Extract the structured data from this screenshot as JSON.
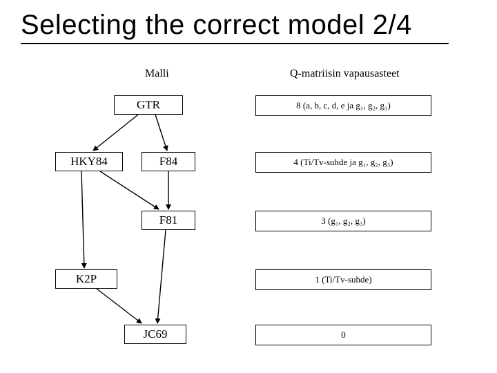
{
  "title": "Selecting the correct model 2/4",
  "columns": {
    "left_header": "Malli",
    "right_header": "Q-matriisin vapausasteet"
  },
  "nodes": {
    "gtr": "GTR",
    "hky84": "HKY84",
    "f84": "F84",
    "f81": "F81",
    "k2p": "K2P",
    "jc69": "JC69"
  },
  "dof": {
    "gtr": "8 (a, b, c, d, e ja g₁, g₂, g₃)",
    "hky": "4 (Ti/Tv-suhde ja g₁, g₂, g₃)",
    "f81": "3 (g₁, g₂, g₃)",
    "k2p": "1 (Ti/Tv-suhde)",
    "jc69": "0"
  },
  "edges": [
    {
      "from": "gtr",
      "to": "hky84"
    },
    {
      "from": "gtr",
      "to": "f84"
    },
    {
      "from": "hky84",
      "to": "f81"
    },
    {
      "from": "f84",
      "to": "f81"
    },
    {
      "from": "hky84",
      "to": "k2p"
    },
    {
      "from": "f81",
      "to": "jc69"
    },
    {
      "from": "k2p",
      "to": "jc69"
    }
  ]
}
